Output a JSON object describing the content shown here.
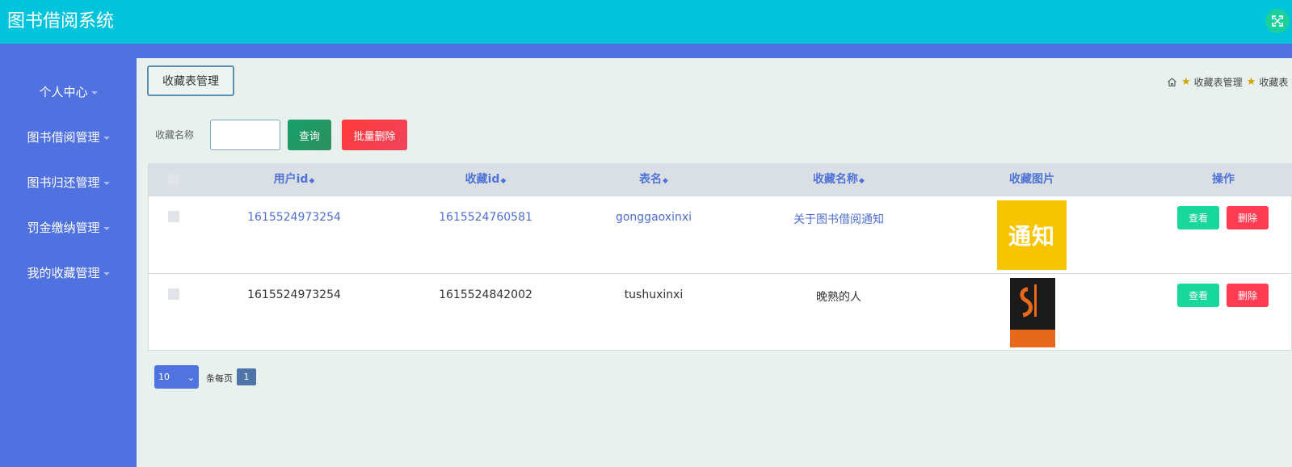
{
  "header": {
    "title": "图书借阅系统"
  },
  "sidebar": {
    "items": [
      {
        "label": "个人中心"
      },
      {
        "label": "图书借阅管理"
      },
      {
        "label": "图书归还管理"
      },
      {
        "label": "罚金缴纳管理"
      },
      {
        "label": "我的收藏管理"
      }
    ]
  },
  "page": {
    "button_label": "收藏表管理",
    "breadcrumb": {
      "item1": "收藏表管理",
      "item2": "收藏表"
    }
  },
  "search": {
    "label": "收藏名称",
    "value": "",
    "query_label": "查询",
    "batch_delete_label": "批量删除"
  },
  "table": {
    "columns": {
      "userid": "用户id",
      "refid": "收藏id",
      "tablename": "表名",
      "name": "收藏名称",
      "picture": "收藏图片",
      "actions": "操作"
    },
    "rows": [
      {
        "userid": "1615524973254",
        "refid": "1615524760581",
        "tablename": "gonggaoxinxi",
        "name": "关于图书借阅通知",
        "picture_text": "通知"
      },
      {
        "userid": "1615524973254",
        "refid": "1615524842002",
        "tablename": "tushuxinxi",
        "name": "晚熟的人",
        "picture_text": "晚熟的人"
      }
    ],
    "view_label": "查看",
    "delete_label": "删除"
  },
  "pagination": {
    "page_size": "10",
    "per_page_label": "条每页",
    "current_page": "1"
  },
  "colors": {
    "topbar": "#00c3dc",
    "sidebar": "#5072e0",
    "background": "#e8f1ed",
    "accent_link": "#4f74d6"
  },
  "icons": {
    "fullscreen": "fullscreen-icon",
    "home": "home-icon",
    "breadcrumb_star": "star-icon",
    "sort": "sort-icon"
  }
}
